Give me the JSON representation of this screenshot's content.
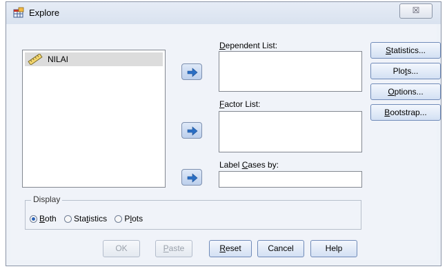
{
  "window": {
    "title": "Explore",
    "close_glyph": "☒"
  },
  "source_list": {
    "items": [
      {
        "label": "NILAI",
        "icon": "scale-ruler-icon"
      }
    ]
  },
  "dependent_list": {
    "label_pre": "",
    "label_u": "D",
    "label_post": "ependent List:"
  },
  "factor_list": {
    "label_pre": "",
    "label_u": "F",
    "label_post": "actor List:"
  },
  "label_cases": {
    "label_pre": "Label ",
    "label_u": "C",
    "label_post": "ases by:"
  },
  "side_buttons": {
    "statistics": {
      "pre": "",
      "u": "S",
      "post": "tatistics..."
    },
    "plots": {
      "pre": "Plo",
      "u": "t",
      "post": "s..."
    },
    "options": {
      "pre": "",
      "u": "O",
      "post": "ptions..."
    },
    "bootstrap": {
      "pre": "",
      "u": "B",
      "post": "ootstrap..."
    }
  },
  "display": {
    "legend": "Display",
    "options": [
      {
        "pre": "",
        "u": "B",
        "post": "oth",
        "checked": true
      },
      {
        "pre": "Sta",
        "u": "t",
        "post": "istics",
        "checked": false
      },
      {
        "pre": "P",
        "u": "l",
        "post": "ots",
        "checked": false
      }
    ]
  },
  "bottom_buttons": {
    "ok": "OK",
    "paste": {
      "u": "P",
      "post": "aste"
    },
    "reset": {
      "u": "R",
      "post": "eset"
    },
    "cancel": "Cancel",
    "help": "Help"
  },
  "colors": {
    "accent": "#2c63b8",
    "window_bg": "#f0f3f9"
  }
}
